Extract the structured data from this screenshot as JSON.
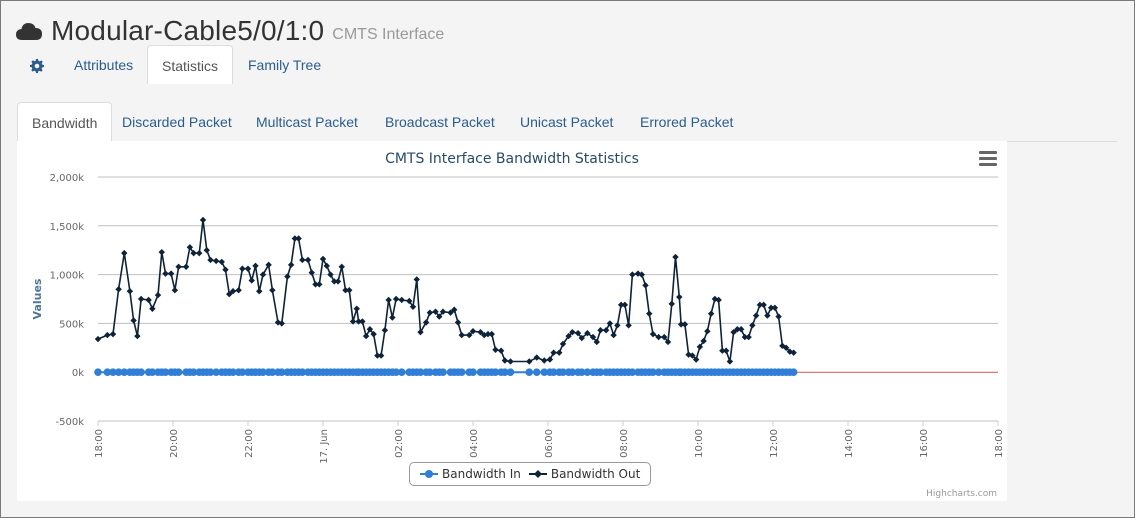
{
  "header": {
    "title": "Modular-Cable5/0/1:0",
    "subtitle": "CMTS Interface",
    "icon": "cloud-icon"
  },
  "main_tabs": [
    {
      "label": "",
      "icon": "gear-icon"
    },
    {
      "label": "Attributes"
    },
    {
      "label": "Statistics",
      "active": true
    },
    {
      "label": "Family Tree"
    }
  ],
  "sub_tabs": [
    {
      "label": "Bandwidth",
      "active": true
    },
    {
      "label": "Discarded Packet"
    },
    {
      "label": "Multicast Packet"
    },
    {
      "label": "Broadcast Packet"
    },
    {
      "label": "Unicast Packet"
    },
    {
      "label": "Errored Packet"
    }
  ],
  "chart_data": {
    "type": "line",
    "title": "CMTS Interface Bandwidth Statistics",
    "ylabel": "Values",
    "xlabel": "",
    "ylim": [
      -500,
      2000
    ],
    "y_ticks": [
      "2,000k",
      "1,500k",
      "1,000k",
      "500k",
      "0k",
      "-500k"
    ],
    "x_ticks": [
      "18:00",
      "20:00",
      "22:00",
      "17. Jun",
      "02:00",
      "04:00",
      "06:00",
      "08:00",
      "10:00",
      "12:00",
      "14:00",
      "16:00",
      "18:00"
    ],
    "x_hours": [
      0,
      2,
      4,
      6,
      8,
      10,
      12,
      14,
      16,
      18,
      20,
      22,
      24
    ],
    "grid": true,
    "legend_position": "bottom-center",
    "credits": "Highcharts.com",
    "colors": {
      "in": "#2f7ed8",
      "out": "#0d233a"
    },
    "series": [
      {
        "name": "Bandwidth In",
        "color": "#2f7ed8",
        "marker": "circle",
        "constant_value": 0
      },
      {
        "name": "Bandwidth Out",
        "color": "#0d233a",
        "marker": "diamond",
        "points": [
          [
            0.0,
            340
          ],
          [
            0.25,
            380
          ],
          [
            0.4,
            390
          ],
          [
            0.55,
            850
          ],
          [
            0.7,
            1220
          ],
          [
            0.85,
            830
          ],
          [
            0.95,
            530
          ],
          [
            1.05,
            370
          ],
          [
            1.15,
            750
          ],
          [
            1.35,
            740
          ],
          [
            1.45,
            650
          ],
          [
            1.6,
            790
          ],
          [
            1.7,
            1230
          ],
          [
            1.8,
            1010
          ],
          [
            1.95,
            1010
          ],
          [
            2.05,
            840
          ],
          [
            2.15,
            1080
          ],
          [
            2.35,
            1080
          ],
          [
            2.45,
            1280
          ],
          [
            2.55,
            1220
          ],
          [
            2.7,
            1220
          ],
          [
            2.8,
            1560
          ],
          [
            2.9,
            1250
          ],
          [
            3.0,
            1150
          ],
          [
            3.15,
            1140
          ],
          [
            3.3,
            1130
          ],
          [
            3.4,
            1050
          ],
          [
            3.5,
            800
          ],
          [
            3.6,
            830
          ],
          [
            3.75,
            840
          ],
          [
            3.85,
            1060
          ],
          [
            4.0,
            1060
          ],
          [
            4.1,
            940
          ],
          [
            4.2,
            1090
          ],
          [
            4.3,
            830
          ],
          [
            4.4,
            1000
          ],
          [
            4.55,
            1100
          ],
          [
            4.65,
            840
          ],
          [
            4.8,
            510
          ],
          [
            4.9,
            500
          ],
          [
            5.05,
            980
          ],
          [
            5.15,
            1100
          ],
          [
            5.25,
            1370
          ],
          [
            5.35,
            1370
          ],
          [
            5.45,
            1150
          ],
          [
            5.6,
            1150
          ],
          [
            5.7,
            1020
          ],
          [
            5.8,
            900
          ],
          [
            5.9,
            900
          ],
          [
            6.0,
            1160
          ],
          [
            6.1,
            1090
          ],
          [
            6.2,
            1000
          ],
          [
            6.3,
            930
          ],
          [
            6.4,
            930
          ],
          [
            6.5,
            1080
          ],
          [
            6.6,
            840
          ],
          [
            6.7,
            840
          ],
          [
            6.8,
            520
          ],
          [
            6.9,
            650
          ],
          [
            6.95,
            520
          ],
          [
            7.05,
            520
          ],
          [
            7.15,
            370
          ],
          [
            7.25,
            440
          ],
          [
            7.35,
            390
          ],
          [
            7.45,
            170
          ],
          [
            7.55,
            170
          ],
          [
            7.65,
            430
          ],
          [
            7.75,
            740
          ],
          [
            7.85,
            560
          ],
          [
            7.95,
            750
          ],
          [
            8.1,
            740
          ],
          [
            8.3,
            730
          ],
          [
            8.4,
            670
          ],
          [
            8.5,
            950
          ],
          [
            8.6,
            410
          ],
          [
            8.75,
            510
          ],
          [
            8.85,
            610
          ],
          [
            9.0,
            620
          ],
          [
            9.1,
            570
          ],
          [
            9.2,
            620
          ],
          [
            9.4,
            610
          ],
          [
            9.5,
            640
          ],
          [
            9.6,
            510
          ],
          [
            9.7,
            380
          ],
          [
            9.9,
            380
          ],
          [
            10.0,
            420
          ],
          [
            10.2,
            410
          ],
          [
            10.3,
            380
          ],
          [
            10.4,
            390
          ],
          [
            10.5,
            390
          ],
          [
            10.6,
            230
          ],
          [
            10.75,
            220
          ],
          [
            10.85,
            120
          ],
          [
            11.0,
            110
          ],
          [
            11.5,
            110
          ],
          [
            11.7,
            150
          ],
          [
            11.9,
            120
          ],
          [
            12.05,
            130
          ],
          [
            12.15,
            200
          ],
          [
            12.3,
            200
          ],
          [
            12.4,
            290
          ],
          [
            12.55,
            370
          ],
          [
            12.65,
            410
          ],
          [
            12.8,
            400
          ],
          [
            12.9,
            350
          ],
          [
            13.05,
            400
          ],
          [
            13.2,
            360
          ],
          [
            13.3,
            310
          ],
          [
            13.4,
            430
          ],
          [
            13.55,
            430
          ],
          [
            13.65,
            500
          ],
          [
            13.75,
            380
          ],
          [
            13.85,
            480
          ],
          [
            13.95,
            690
          ],
          [
            14.05,
            690
          ],
          [
            14.15,
            480
          ],
          [
            14.25,
            1000
          ],
          [
            14.4,
            1010
          ],
          [
            14.5,
            1000
          ],
          [
            14.6,
            890
          ],
          [
            14.7,
            600
          ],
          [
            14.8,
            390
          ],
          [
            14.95,
            360
          ],
          [
            15.1,
            360
          ],
          [
            15.2,
            310
          ],
          [
            15.3,
            700
          ],
          [
            15.4,
            1180
          ],
          [
            15.5,
            770
          ],
          [
            15.55,
            490
          ],
          [
            15.65,
            490
          ],
          [
            15.75,
            180
          ],
          [
            15.85,
            170
          ],
          [
            15.95,
            130
          ],
          [
            16.05,
            260
          ],
          [
            16.15,
            320
          ],
          [
            16.25,
            420
          ],
          [
            16.35,
            600
          ],
          [
            16.45,
            750
          ],
          [
            16.55,
            740
          ],
          [
            16.65,
            220
          ],
          [
            16.75,
            220
          ],
          [
            16.85,
            110
          ],
          [
            16.95,
            410
          ],
          [
            17.05,
            440
          ],
          [
            17.15,
            440
          ],
          [
            17.25,
            360
          ],
          [
            17.35,
            360
          ],
          [
            17.45,
            480
          ],
          [
            17.55,
            580
          ],
          [
            17.65,
            690
          ],
          [
            17.75,
            690
          ],
          [
            17.85,
            580
          ],
          [
            17.95,
            660
          ],
          [
            18.05,
            660
          ],
          [
            18.15,
            570
          ],
          [
            18.25,
            270
          ],
          [
            18.35,
            250
          ],
          [
            18.45,
            210
          ],
          [
            18.55,
            200
          ]
        ]
      }
    ]
  }
}
